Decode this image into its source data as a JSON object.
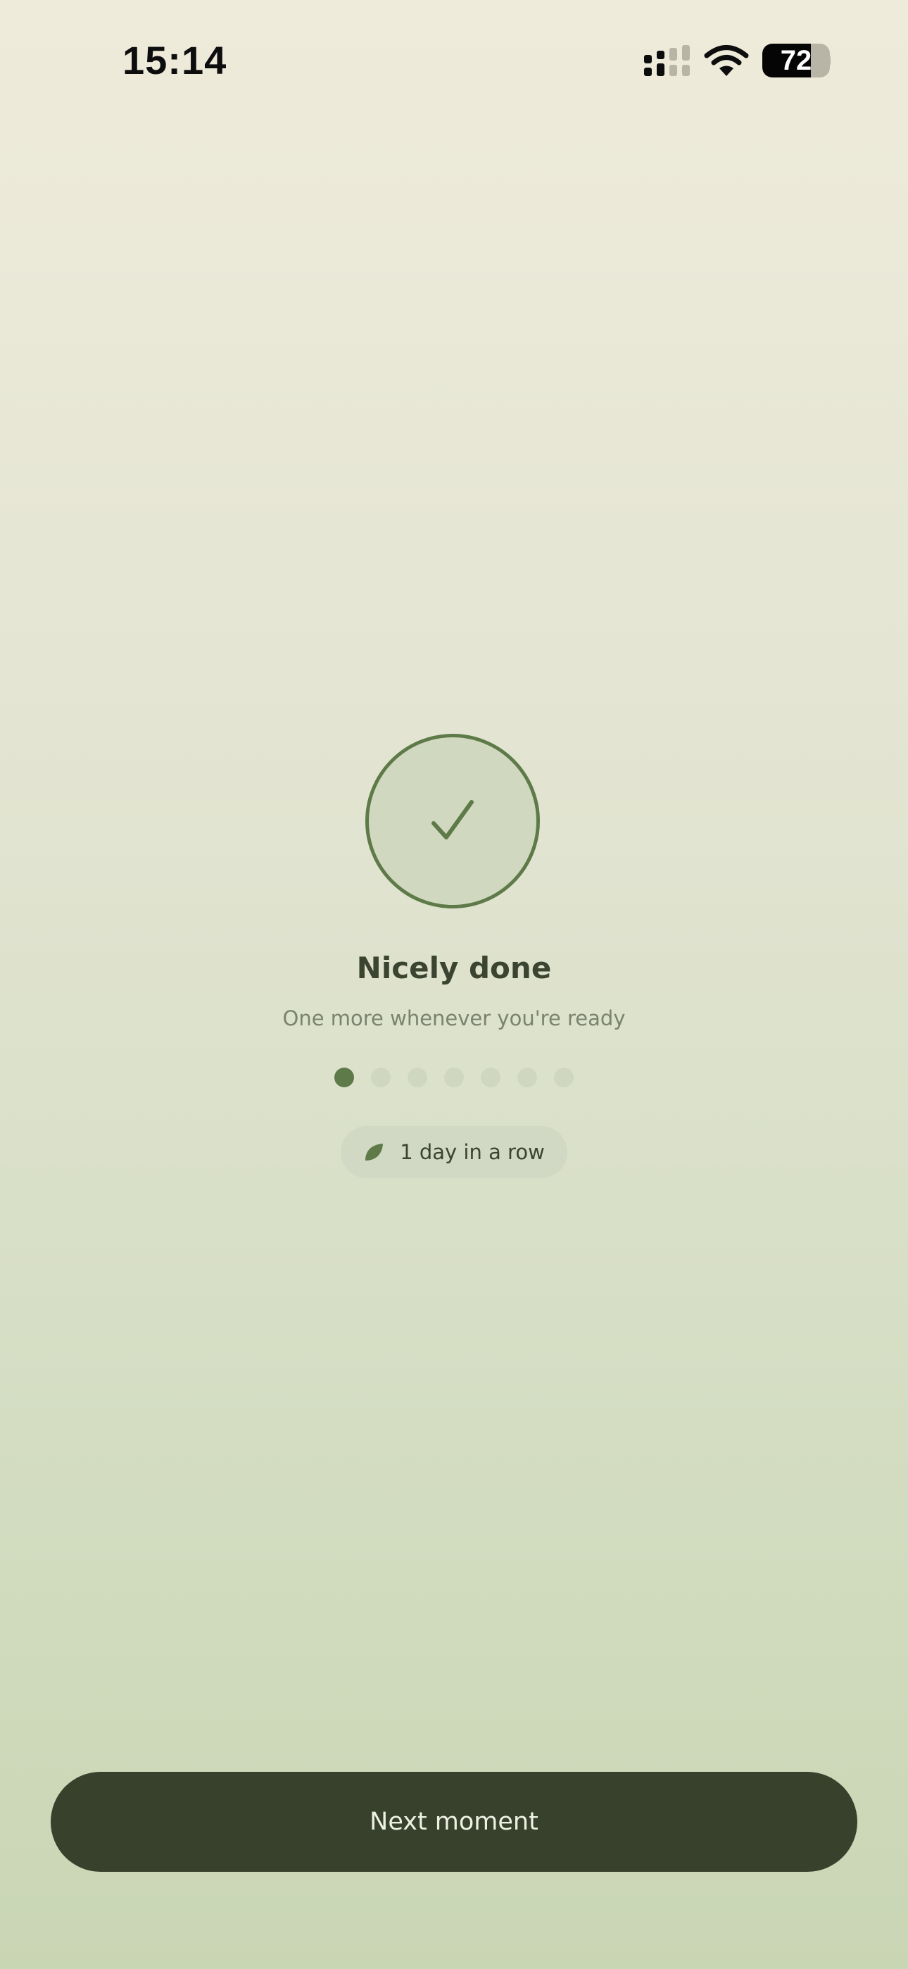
{
  "status_bar": {
    "time": "15:14",
    "battery_level": "72",
    "battery_fraction": 0.72,
    "icons": [
      "cellular-signal-icon",
      "wifi-icon",
      "battery-icon"
    ]
  },
  "completion": {
    "icon": "checkmark-icon",
    "title": "Nicely done",
    "subtitle": "One more whenever you're ready"
  },
  "progress": {
    "total": 7,
    "completed": 1
  },
  "streak": {
    "icon": "leaf-icon",
    "label": "1 day in a row"
  },
  "actions": {
    "next_label": "Next moment"
  },
  "colors": {
    "accent": "#5e7a48",
    "button": "#37412b",
    "text": "#3b4431",
    "muted_text": "#7a8270"
  }
}
